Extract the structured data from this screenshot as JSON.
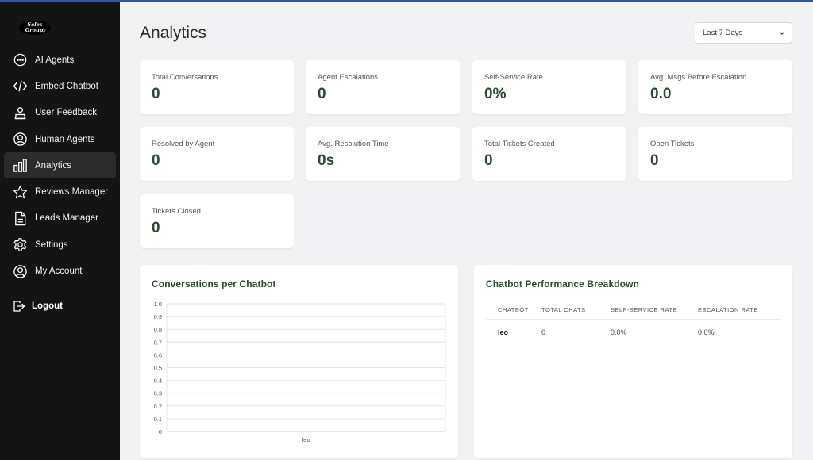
{
  "sidebar": {
    "logo_text": "Sales Group",
    "items": [
      {
        "label": "AI Agents",
        "icon": "chat-bubble-icon",
        "active": false
      },
      {
        "label": "Embed Chatbot",
        "icon": "code-icon",
        "active": false
      },
      {
        "label": "User Feedback",
        "icon": "feedback-icon",
        "active": false
      },
      {
        "label": "Human Agents",
        "icon": "user-circle-icon",
        "active": false
      },
      {
        "label": "Analytics",
        "icon": "bar-chart-icon",
        "active": true
      },
      {
        "label": "Reviews Manager",
        "icon": "star-icon",
        "active": false
      },
      {
        "label": "Leads Manager",
        "icon": "document-icon",
        "active": false
      },
      {
        "label": "Settings",
        "icon": "gear-icon",
        "active": false
      },
      {
        "label": "My Account",
        "icon": "account-icon",
        "active": false
      }
    ],
    "logout_label": "Logout"
  },
  "header": {
    "title": "Analytics",
    "range_select": {
      "selected": "Last 7 Days"
    }
  },
  "stats": [
    {
      "label": "Total Conversations",
      "value": "0"
    },
    {
      "label": "Agent Escalations",
      "value": "0"
    },
    {
      "label": "Self-Service Rate",
      "value": "0%"
    },
    {
      "label": "Avg. Msgs Before Escalation",
      "value": "0.0"
    },
    {
      "label": "Resolved by Agent",
      "value": "0"
    },
    {
      "label": "Avg. Resolution Time",
      "value": "0s"
    },
    {
      "label": "Total Tickets Created",
      "value": "0"
    },
    {
      "label": "Open Tickets",
      "value": "0"
    },
    {
      "label": "Tickets Closed",
      "value": "0"
    }
  ],
  "conversations_panel": {
    "title": "Conversations per Chatbot"
  },
  "chart_data": {
    "type": "bar",
    "title": "Conversations per Chatbot",
    "categories": [
      "leo"
    ],
    "values": [
      0
    ],
    "ylim": [
      0,
      1
    ],
    "yticks": [
      "1.0",
      "0.9",
      "0.8",
      "0.7",
      "0.6",
      "0.5",
      "0.4",
      "0.3",
      "0.2",
      "0.1",
      "0"
    ],
    "grid": true
  },
  "performance_panel": {
    "title": "Chatbot Performance Breakdown",
    "columns": [
      "CHATBOT",
      "TOTAL CHATS",
      "SELF-SERVICE RATE",
      "ESCALATION RATE"
    ],
    "rows": [
      {
        "chatbot": "leo",
        "total_chats": "0",
        "self_service_rate": "0.0%",
        "escalation_rate": "0.0%"
      }
    ]
  },
  "colors": {
    "accent": "#2f55a4",
    "value_text": "#2c4a33",
    "sidebar_bg": "#141414",
    "active_item_bg": "#2b2b2b",
    "page_bg": "#f2f2f4"
  }
}
